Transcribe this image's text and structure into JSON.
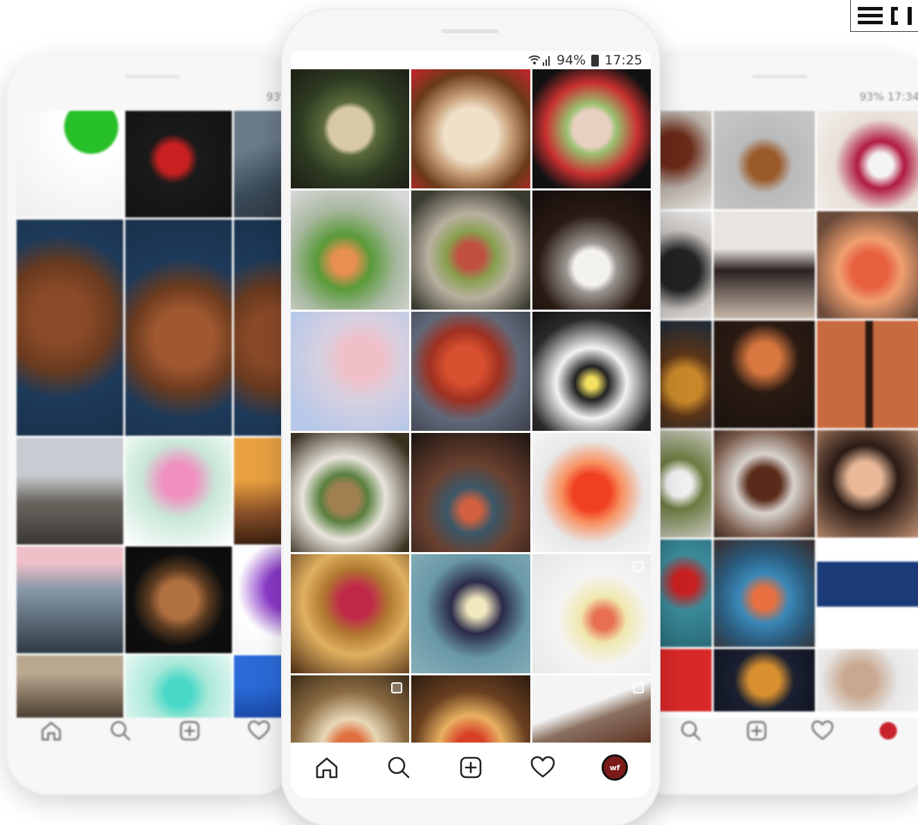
{
  "status_bar": {
    "battery": "94%",
    "time": "17:25"
  },
  "left_phone": {
    "status": "93%"
  },
  "right_phone": {
    "status": "93% 17:34"
  },
  "profile_avatar": {
    "text": "wf"
  },
  "icons": {
    "home": "home-icon",
    "search": "search-icon",
    "add": "add-post-icon",
    "activity": "heart-icon",
    "profile": "avatar"
  },
  "colors": {
    "accent_red": "#c8232c",
    "nav_icon": "#222222"
  },
  "grid_tiles": [
    {
      "name": "seafood-salad",
      "bg": "radial-gradient(circle at 50% 50%, #d8c8a8 0 25%, #5a6a3a 32%, #2e3a22 60%, #1b1f14 100%)"
    },
    {
      "name": "dim-sum-basket",
      "bg": "radial-gradient(circle at 50% 55%, #f0e0c8 0 30%, #c8a07a 45%, #6a3a1a 70%, #c8232c 100%)"
    },
    {
      "name": "shrimp-sandwich",
      "bg": "radial-gradient(circle at 50% 50%, #e8d0c0 0 22%, #9ac070 30%, #c83030 55%, #111 80%)"
    },
    {
      "name": "shrimp-salad",
      "bg": "radial-gradient(circle at 45% 60%, #e89050 0 12%, #5a9a3a 28%, #a8b8a0 55%, #d8d8d8 90%)"
    },
    {
      "name": "vegetable-tartare",
      "bg": "radial-gradient(circle at 50% 55%, #c05040 0 14%, #88a050 28%, #b8b0a0 48%, #3a3a30 85%)"
    },
    {
      "name": "plated-dessert",
      "bg": "radial-gradient(circle at 50% 65%, #f4f2ee 0 18%, #9a9590 26%, #2a1a14 55%, #120c0a 100%)"
    },
    {
      "name": "pink-cocktail",
      "bg": "radial-gradient(circle at 60% 40%, #f0c0c8 0 20%, #d8d0e0 40%, #b8c8e8 80%)"
    },
    {
      "name": "crab-legs",
      "bg": "radial-gradient(circle at 45% 45%, #d85030 0 20%, #a03020 38%, #606878 60%, #3a3f4a 100%)"
    },
    {
      "name": "squid-ink-pasta",
      "bg": "radial-gradient(circle at 50% 60%, #f4e060 0 6%, #222 18%, #f2f2f2 38%, #2a2a2a 70%, #111 100%)"
    },
    {
      "name": "sardine-toast",
      "bg": "radial-gradient(circle at 45% 55%, #a08050 0 16%, #5a8040 26%, #e8e4dc 45%, #3a3020 85%)"
    },
    {
      "name": "wine-tartare",
      "bg": "radial-gradient(circle at 50% 65%, #d06040 0 10%, #3a5868 24%, #6a4030 48%, #1a1410 100%)"
    },
    {
      "name": "red-lemonade",
      "bg": "radial-gradient(circle at 50% 50%, #f04020 0 22%, #f89060 36%, #e8e8e8 62%, #f6f6f6 100%)"
    },
    {
      "name": "berry-dessert",
      "bg": "radial-gradient(circle at 55% 40%, #c0284a 0 16%, #b07830 34%, #e0b060 55%, #4a2a12 100%)"
    },
    {
      "name": "champagne",
      "bg": "radial-gradient(circle at 55% 45%, #f2e8c0 0 10%, #2a2a48 28%, #6a98a8 55%, #88b0b8 100%)"
    },
    {
      "name": "ceviche",
      "bg": "radial-gradient(circle at 60% 55%, #e87050 0 10%, #f0e8b0 24%, #f4f4f4 48%, #e6e6e6 100%)"
    },
    {
      "name": "salmon-tart",
      "bg": "radial-gradient(circle at 50% 60%, #e07040 0 14%, #e8d8b8 30%, #8a6a40 60%, #3a2a18 100%)"
    },
    {
      "name": "pizza",
      "bg": "radial-gradient(circle at 50% 60%, #d84028 0 14%, #e8b060 34%, #6a4020 60%, #2a1a10 100%)"
    },
    {
      "name": "tapas-table",
      "bg": "linear-gradient(160deg, #f4f4f4 0 30%, #8a7060 42%, #5a3020 70%, #3a2a20 100%)"
    }
  ],
  "left_tiles": [
    {
      "name": "green-promo",
      "bg": "radial-gradient(circle at 70% 15%, #28c028 0 22%, #ffffff 24%, #eeeeee 100%)"
    },
    {
      "name": "dark-logo",
      "bg": "radial-gradient(circle at 45% 45%, #c82020 0 18%, #1a1a1a 30%, #111 100%)"
    },
    {
      "name": "coast",
      "bg": "linear-gradient(160deg, #6a7a88 0 30%, #3a4a58 60%, #2a3038 100%)"
    },
    {
      "name": "steak-boards",
      "bg": "radial-gradient(circle at 40% 45%, #8a4a28 0 20%, #6a3a1e 40%, #1e3a5a 60%, #18304a 100%)"
    },
    {
      "name": "steak-boards-2",
      "bg": "radial-gradient(circle at 55% 55%, #a05830 0 22%, #6a3a1e 40%, #1e3a5a 60%, #18304a 100%)"
    },
    {
      "name": "steak-boards-3",
      "bg": "radial-gradient(circle at 40% 55%, #8a4a28 0 20%, #6a3a1e 38%, #1e3a5a 60%, #18304a 100%)"
    },
    {
      "name": "road",
      "bg": "linear-gradient(180deg, #c8ccd2 0 35%, #6a6660 60%, #3a3834 100%)"
    },
    {
      "name": "flowers",
      "bg": "radial-gradient(circle at 50% 40%, #f090c0 0 20%, #c8e8d8 45%, #ffffff 100%)"
    },
    {
      "name": "sunset-desert",
      "bg": "linear-gradient(180deg, #e8a040 0 40%, #8a5028 70%, #3a2010 100%)"
    },
    {
      "name": "sea-waves",
      "bg": "linear-gradient(180deg, #f0c0c8 0 15%, #8898a8 40%, #2e3a44 100%)"
    },
    {
      "name": "plate-dark",
      "bg": "radial-gradient(circle at 50% 50%, #b07040 0 25%, #5a3a20 40%, #0e0e0e 62%, #0a0a0a 100%)"
    },
    {
      "name": "purple-flowers",
      "bg": "radial-gradient(circle at 50% 40%, #8a3ac8 0 25%, #ffffff 60%, #f4f4f4 100%)"
    },
    {
      "name": "dunes",
      "bg": "linear-gradient(180deg, #b8a890 0 30%, #7a6a58 70%, #4a3e32 100%)"
    },
    {
      "name": "green-drinks",
      "bg": "radial-gradient(circle at 50% 60%, #48d8c8 0 20%, #a8e8d8 45%, #e8f8f4 100%)"
    },
    {
      "name": "blue-web",
      "bg": "linear-gradient(180deg, #2a6ad8 0 50%, #1a4aa8 100%)"
    }
  ],
  "right_tiles": [
    {
      "name": "meat-dish",
      "bg": "radial-gradient(circle at 30% 40%, #6a2a18 0 25%, #b8b0a8 55%, #e8e4e0 100%)"
    },
    {
      "name": "menu-board",
      "bg": "radial-gradient(circle at 50% 55%, #9a5a2a 0 20%, #bababa 38%, #c8c8c8 100%)"
    },
    {
      "name": "ice-cream-cherry",
      "bg": "radial-gradient(circle at 60% 55%, #f4f4f4 0 14%, #b01840 28%, #e8e0d8 55%, #f4f0ec 100%)"
    },
    {
      "name": "vinyl",
      "bg": "radial-gradient(circle at 40% 55%, #222 0 30%, #c8c4c0 60%, #e8e8e8 100%)"
    },
    {
      "name": "models",
      "bg": "linear-gradient(180deg, #e8e4e0 0 35%, #2a2020 55%, #c8b8a8 100%)"
    },
    {
      "name": "shrimp-plate",
      "bg": "radial-gradient(circle at 50% 55%, #e86040 0 22%, #f0a070 40%, #6a4a3a 80%)"
    },
    {
      "name": "dumplings",
      "bg": "radial-gradient(circle at 50% 60%, #c8882a 0 24%, #5a3418 45%, #1a2a3a 100%)"
    },
    {
      "name": "poster",
      "bg": "radial-gradient(circle at 50% 35%, #d87840 0 18%, #2a1a12 40%, #1a120e 100%)"
    },
    {
      "name": "brick-wall",
      "bg": "linear-gradient(90deg, #c86a40 0 45%, #2a1a10 46% 52%, #c86a40 53% 100%)"
    },
    {
      "name": "wine-glass",
      "bg": "radial-gradient(circle at 40% 50%, #f0f0f0 0 20%, #6a7a40 40%, #c8c8c0 100%)"
    },
    {
      "name": "steak-plate",
      "bg": "radial-gradient(circle at 50% 50%, #5a2a1a 0 22%, #d8d4d0 40%, #7a5a4a 75%, #3a2a20 100%)"
    },
    {
      "name": "smoking-woman",
      "bg": "radial-gradient(circle at 45% 45%, #e8b898 0 20%, #2a1a14 40%, #c89878 100%)"
    },
    {
      "name": "strawberry",
      "bg": "radial-gradient(circle at 50% 40%, #c82020 0 16%, #3a8a9a 40%, #2a6a78 100%)"
    },
    {
      "name": "salmon-blue-plate",
      "bg": "radial-gradient(circle at 50% 55%, #e87040 0 14%, #3a88b8 32%, #2a5878 60%, #3a2a28 100%)"
    },
    {
      "name": "monitor",
      "bg": "linear-gradient(180deg, #ffffff 0 20%, #1a3a78 21% 62%, #ffffff 63% 100%)"
    },
    {
      "name": "red-sign",
      "bg": "linear-gradient(180deg, #d82828 0 100%)"
    },
    {
      "name": "fried-balls",
      "bg": "radial-gradient(circle at 50% 50%, #d89030 0 26%, #1a2030 50%, #0e1420 100%)"
    },
    {
      "name": "woman-portrait",
      "bg": "radial-gradient(circle at 40% 50%, #c8a890 0 22%, #e8e8e8 55%, #f2f2f2 100%)"
    }
  ]
}
